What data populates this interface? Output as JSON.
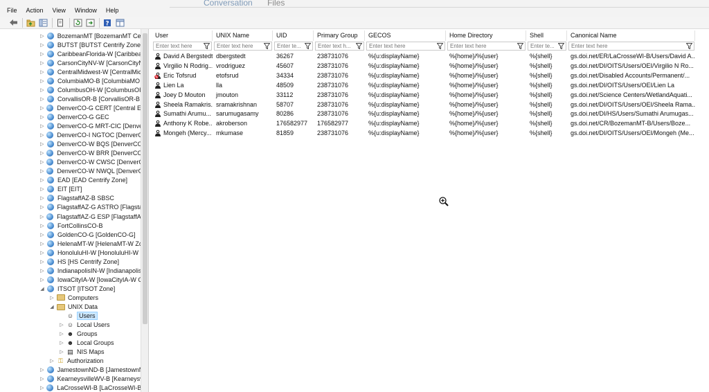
{
  "background_tabs": [
    "Conversation",
    "Files"
  ],
  "menu": [
    "File",
    "Action",
    "View",
    "Window",
    "Help"
  ],
  "toolbar_icons": [
    "back-arrow-icon",
    "folder-up-icon",
    "show-hide-tree-icon",
    "delete-icon",
    "properties-icon",
    "refresh-icon",
    "export-icon",
    "help-icon",
    "console-view-icon"
  ],
  "tree": [
    {
      "label": "BozemanMT [BozemanMT Cer",
      "icon": "globe",
      "depth": 0,
      "expand": "closed"
    },
    {
      "label": "BUTST [BUTST Centrify Zone]",
      "icon": "globe",
      "depth": 0,
      "expand": "closed"
    },
    {
      "label": "CaribbeanFlorida-W [Caribbear",
      "icon": "globe",
      "depth": 0,
      "expand": "closed"
    },
    {
      "label": "CarsonCityNV-W [CarsonCityN",
      "icon": "globe",
      "depth": 0,
      "expand": "closed"
    },
    {
      "label": "CentralMidwest-W [CentralMic",
      "icon": "globe",
      "depth": 0,
      "expand": "closed"
    },
    {
      "label": "ColumbiaMO-B [ColumbiaMO",
      "icon": "globe",
      "depth": 0,
      "expand": "closed"
    },
    {
      "label": "ColumbusOH-W [ColumbusOI",
      "icon": "globe",
      "depth": 0,
      "expand": "closed"
    },
    {
      "label": "CorvallisOR-B [CorvallisOR-B",
      "icon": "globe",
      "depth": 0,
      "expand": "closed"
    },
    {
      "label": "DenverCO-G CERT [Central Ene",
      "icon": "globe",
      "depth": 0,
      "expand": "closed"
    },
    {
      "label": "DenverCO-G GEC",
      "icon": "globe",
      "depth": 0,
      "expand": "closed"
    },
    {
      "label": "DenverCO-G MRT-CIC [Denver",
      "icon": "globe",
      "depth": 0,
      "expand": "closed"
    },
    {
      "label": "DenverCO-I NGTOC [DenverCO",
      "icon": "globe",
      "depth": 0,
      "expand": "closed"
    },
    {
      "label": "DenverCO-W BQS [DenverCO-\\",
      "icon": "globe",
      "depth": 0,
      "expand": "closed"
    },
    {
      "label": "DenverCO-W BRR [DenverCO-V",
      "icon": "globe",
      "depth": 0,
      "expand": "closed"
    },
    {
      "label": "DenverCO-W CWSC [DenverCO",
      "icon": "globe",
      "depth": 0,
      "expand": "closed"
    },
    {
      "label": "DenverCO-W NWQL [DenverCO",
      "icon": "globe",
      "depth": 0,
      "expand": "closed"
    },
    {
      "label": "EAD [EAD Centrify Zone]",
      "icon": "globe",
      "depth": 0,
      "expand": "closed"
    },
    {
      "label": "EIT [EIT]",
      "icon": "globe",
      "depth": 0,
      "expand": "closed"
    },
    {
      "label": "FlagstaffAZ-B SBSC",
      "icon": "globe",
      "depth": 0,
      "expand": "closed"
    },
    {
      "label": "FlagstaffAZ-G ASTRO [Flagstaff",
      "icon": "globe",
      "depth": 0,
      "expand": "closed"
    },
    {
      "label": "FlagstaffAZ-G ESP [FlagstaffAZ ≡",
      "icon": "globe",
      "depth": 0,
      "expand": "closed"
    },
    {
      "label": "FortCollinsCO-B",
      "icon": "globe",
      "depth": 0,
      "expand": "closed"
    },
    {
      "label": "GoldenCO-G [GoldenCO-G]",
      "icon": "globe",
      "depth": 0,
      "expand": "closed"
    },
    {
      "label": "HelenaMT-W [HelenaMT-W Zc",
      "icon": "globe",
      "depth": 0,
      "expand": "closed"
    },
    {
      "label": "HonoluluHI-W [HonoluluHI-W",
      "icon": "globe",
      "depth": 0,
      "expand": "closed"
    },
    {
      "label": "HS [HS Centrify Zone]",
      "icon": "globe",
      "depth": 0,
      "expand": "closed"
    },
    {
      "label": "IndianapolisIN-W [Indianapolis",
      "icon": "globe",
      "depth": 0,
      "expand": "closed"
    },
    {
      "label": "IowaCityIA-W [IowaCityIA-W C",
      "icon": "globe",
      "depth": 0,
      "expand": "closed"
    },
    {
      "label": "ITSOT [ITSOT Zone]",
      "icon": "globe",
      "depth": 0,
      "expand": "open"
    },
    {
      "label": "Computers",
      "icon": "folder",
      "depth": 1,
      "expand": "closed"
    },
    {
      "label": "UNIX Data",
      "icon": "folder",
      "depth": 1,
      "expand": "open"
    },
    {
      "label": "Users",
      "icon": "user",
      "depth": 2,
      "expand": "none",
      "selected": true
    },
    {
      "label": "Local Users",
      "icon": "user",
      "depth": 2,
      "expand": "closed"
    },
    {
      "label": "Groups",
      "icon": "group",
      "depth": 2,
      "expand": "closed"
    },
    {
      "label": "Local Groups",
      "icon": "group",
      "depth": 2,
      "expand": "closed"
    },
    {
      "label": "NIS Maps",
      "icon": "map",
      "depth": 2,
      "expand": "closed"
    },
    {
      "label": "Authorization",
      "icon": "key",
      "depth": 1,
      "expand": "closed"
    },
    {
      "label": "JamestownND-B [JamestownN",
      "icon": "globe",
      "depth": 0,
      "expand": "closed"
    },
    {
      "label": "KearneysvilleWV-B [Kearneysvil",
      "icon": "globe",
      "depth": 0,
      "expand": "closed"
    },
    {
      "label": "LaCrosseWI-B [LaCrosseWI-B C",
      "icon": "globe",
      "depth": 0,
      "expand": "closed"
    }
  ],
  "grid": {
    "columns": [
      "User",
      "UNIX Name",
      "UID",
      "Primary Group",
      "GECOS",
      "Home Directory",
      "Shell",
      "Canonical Name"
    ],
    "filter_placeholders": [
      "Enter text here",
      "Enter text here",
      "Enter te...",
      "Enter text h...",
      "Enter text here",
      "Enter text here",
      "Enter te...",
      "Enter text here"
    ],
    "rows": [
      {
        "user": "David A Bergstedt",
        "unix": "dbergstedt",
        "uid": "36267",
        "group": "238731076",
        "gecos": "%{u:displayName}",
        "home": "%{home}/%{user}",
        "shell": "%{shell}",
        "canonical": "gs.doi.net/ER/LaCrosseWI-B/Users/David A...",
        "icon": "user"
      },
      {
        "user": "Virgilio N Rodrig...",
        "unix": "vrodriguez",
        "uid": "45607",
        "group": "238731076",
        "gecos": "%{u:displayName}",
        "home": "%{home}/%{user}",
        "shell": "%{shell}",
        "canonical": "gs.doi.net/DI/OITS/Users/OEI/Virgilio N Ro...",
        "icon": "user"
      },
      {
        "user": "Eric Tofsrud",
        "unix": "etofsrud",
        "uid": "34334",
        "group": "238731076",
        "gecos": "%{u:displayName}",
        "home": "%{home}/%{user}",
        "shell": "%{shell}",
        "canonical": "gs.doi.net/Disabled Accounts/Permanent/...",
        "icon": "user-disabled"
      },
      {
        "user": "Lien La",
        "unix": "lla",
        "uid": "48509",
        "group": "238731076",
        "gecos": "%{u:displayName}",
        "home": "%{home}/%{user}",
        "shell": "%{shell}",
        "canonical": "gs.doi.net/DI/OITS/Users/OEI/Lien La",
        "icon": "user"
      },
      {
        "user": "Joey D Mouton",
        "unix": "jmouton",
        "uid": "33112",
        "group": "238731076",
        "gecos": "%{u:displayName}",
        "home": "%{home}/%{user}",
        "shell": "%{shell}",
        "canonical": "gs.doi.net/Science Centers/WetlandAquati...",
        "icon": "user"
      },
      {
        "user": "Sheela Ramakris...",
        "unix": "sramakrishnan",
        "uid": "58707",
        "group": "238731076",
        "gecos": "%{u:displayName}",
        "home": "%{home}/%{user}",
        "shell": "%{shell}",
        "canonical": "gs.doi.net/DI/OITS/Users/OEI/Sheela Rama...",
        "icon": "user"
      },
      {
        "user": "Sumathi Arumu...",
        "unix": "sarumugasamy",
        "uid": "80286",
        "group": "238731076",
        "gecos": "%{u:displayName}",
        "home": "%{home}/%{user}",
        "shell": "%{shell}",
        "canonical": "gs.doi.net/DI/HS/Users/Sumathi Arumugas...",
        "icon": "user"
      },
      {
        "user": "Anthony K Robe...",
        "unix": "akroberson",
        "uid": "176582977",
        "group": "176582977",
        "gecos": "%{u:displayName}",
        "home": "%{home}/%{user}",
        "shell": "%{shell}",
        "canonical": "gs.doi.net/CR/BozemanMT-B/Users/Boze...",
        "icon": "user"
      },
      {
        "user": "Mongeh (Mercy...",
        "unix": "mkumase",
        "uid": "81859",
        "group": "238731076",
        "gecos": "%{u:displayName}",
        "home": "%{home}/%{user}",
        "shell": "%{shell}",
        "canonical": "gs.doi.net/DI/OITS/Users/OEI/Mongeh (Me...",
        "icon": "user"
      }
    ]
  },
  "colors": {
    "selection": "#cce8ff",
    "selection_border": "#99d1ff",
    "globe": "#3a7fc8",
    "disabled_badge": "#d8202a"
  }
}
